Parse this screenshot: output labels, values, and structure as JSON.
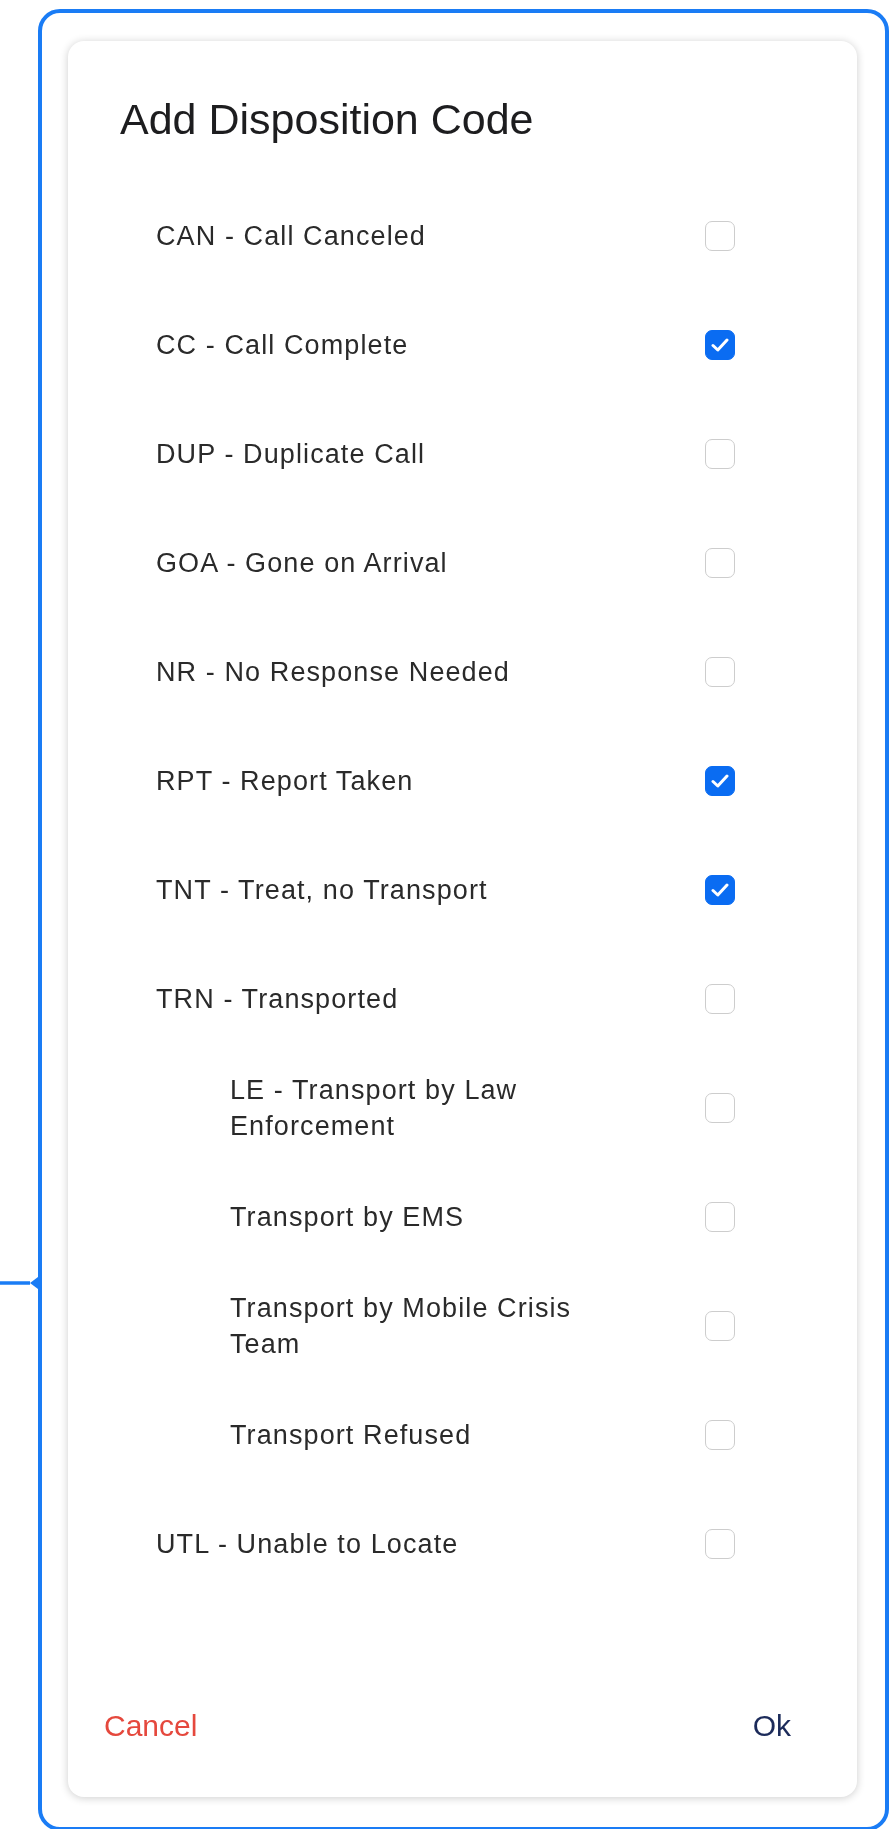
{
  "dialog": {
    "title": "Add Disposition Code",
    "options": [
      {
        "label": "CAN - Call Canceled",
        "checked": false
      },
      {
        "label": "CC - Call Complete",
        "checked": true
      },
      {
        "label": "DUP - Duplicate Call",
        "checked": false
      },
      {
        "label": "GOA - Gone on Arrival",
        "checked": false
      },
      {
        "label": "NR - No Response Needed",
        "checked": false
      },
      {
        "label": "RPT - Report Taken",
        "checked": true
      },
      {
        "label": "TNT - Treat, no Transport",
        "checked": true
      },
      {
        "label": "TRN - Transported",
        "checked": false,
        "children": [
          {
            "label": "LE - Transport by Law Enforcement",
            "checked": false
          },
          {
            "label": "Transport by EMS",
            "checked": false
          },
          {
            "label": "Transport by Mobile Crisis Team",
            "checked": false
          },
          {
            "label": "Transport Refused",
            "checked": false
          }
        ]
      },
      {
        "label": "UTL - Unable to Locate",
        "checked": false
      }
    ],
    "buttons": [
      {
        "kind": "cancel",
        "label": "Cancel"
      },
      {
        "kind": "ok",
        "label": "Ok"
      }
    ]
  }
}
